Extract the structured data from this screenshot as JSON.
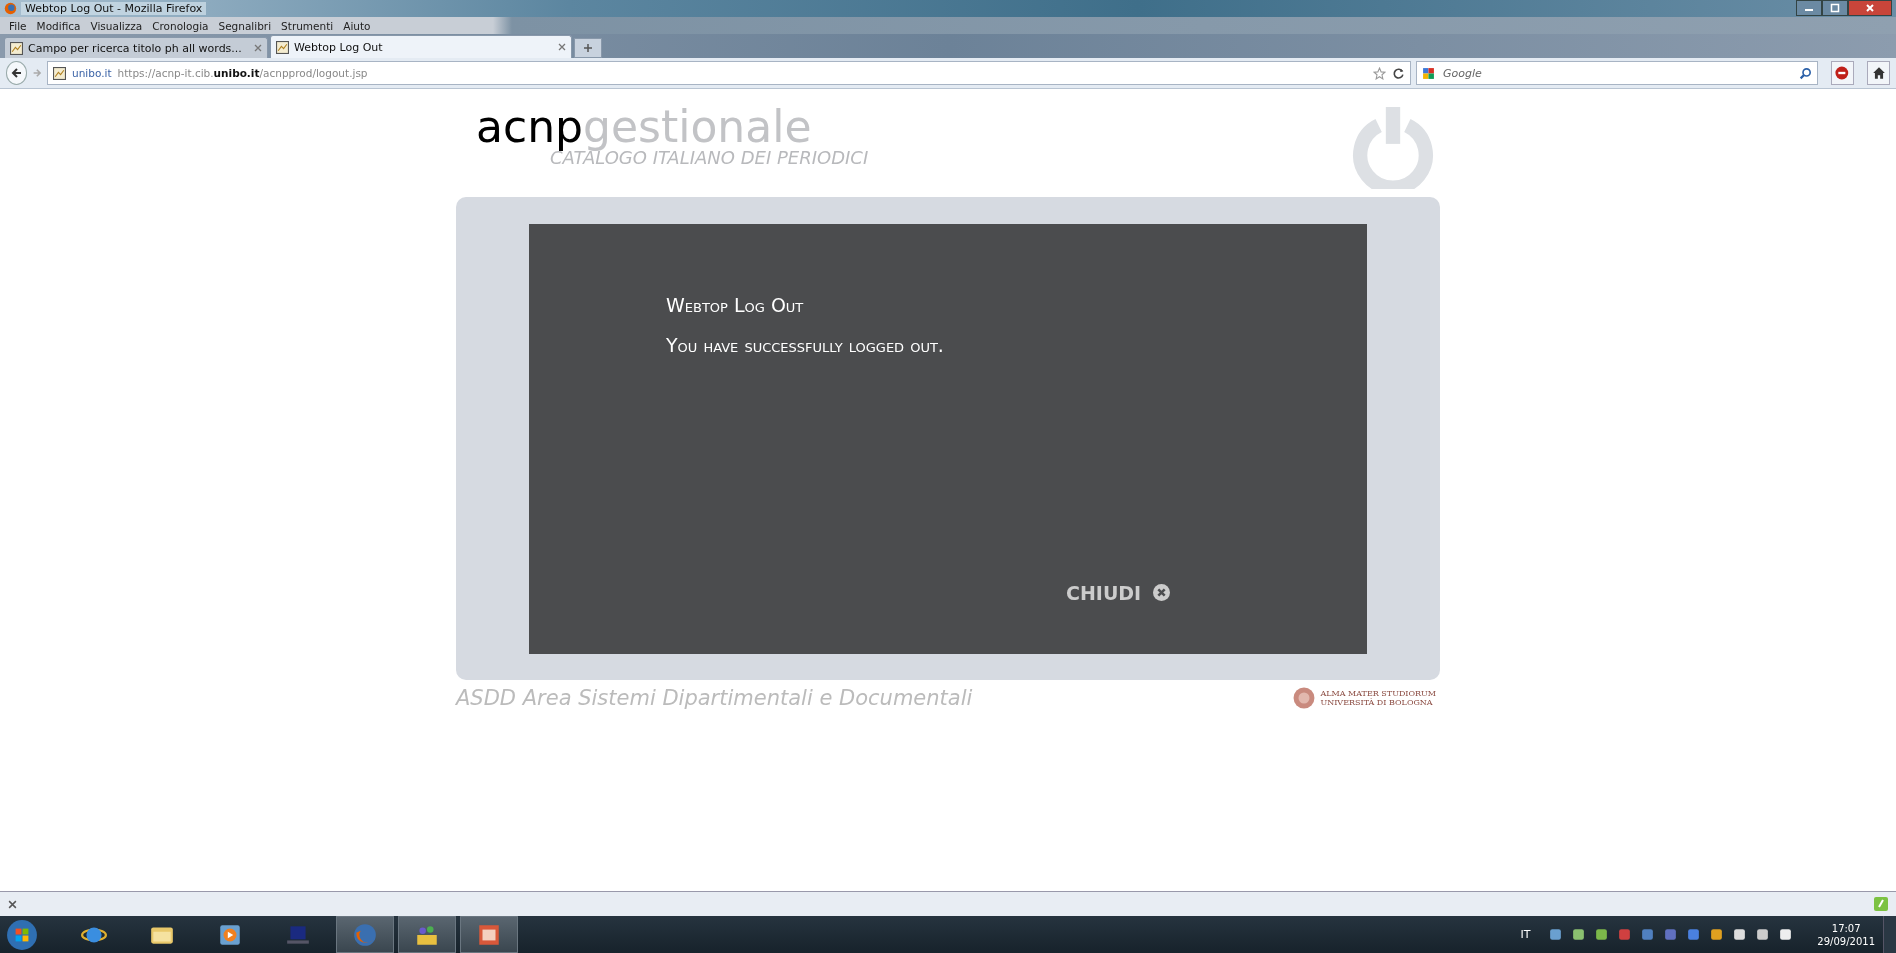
{
  "window": {
    "title": "Webtop Log Out - Mozilla Firefox"
  },
  "menu": [
    "File",
    "Modifica",
    "Visualizza",
    "Cronologia",
    "Segnalibri",
    "Strumenti",
    "Aiuto"
  ],
  "tabs": [
    {
      "label": "Campo per ricerca titolo ph all words...",
      "selected": false
    },
    {
      "label": "Webtop Log Out",
      "selected": true
    }
  ],
  "address": {
    "site": "unibo.it",
    "url_start": "https://acnp-it.cib.",
    "url_domain": "unibo.it",
    "url_end": "/acnpprod/logout.jsp"
  },
  "search": {
    "placeholder": "Google"
  },
  "page": {
    "logo_bold": "acnp",
    "logo_light": "gestionale",
    "subtitle": "CATALOGO ITALIANO DEI PERIODICI",
    "heading": "Webtop Log Out",
    "message": "You have successfully logged out.",
    "close_label": "CHIUDI",
    "footer": "ASDD Area Sistemi Dipartimentali e Documentali",
    "university_line1": "ALMA MATER STUDIORUM",
    "university_line2": "UNIVERSITÀ DI BOLOGNA"
  },
  "taskbar": {
    "language": "IT",
    "time": "17:07",
    "date": "29/09/2011"
  }
}
